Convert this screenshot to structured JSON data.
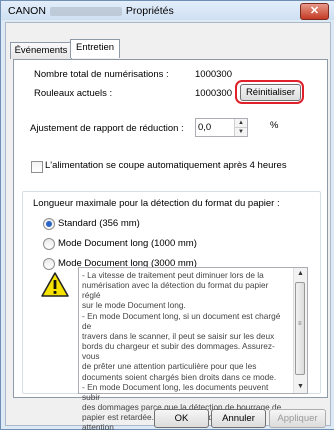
{
  "window": {
    "title_prefix": "CANON",
    "title_suffix": "Propriétés",
    "close_glyph": "✕"
  },
  "tabs": [
    {
      "label": "Événements",
      "active": false
    },
    {
      "label": "Entretien",
      "active": true
    }
  ],
  "scans": {
    "total_label": "Nombre total de numérisations :",
    "total_value": "1000300",
    "rollers_label": "Rouleaux actuels :",
    "rollers_value": "1000300",
    "reset_label": "Réinitialiser"
  },
  "reduction": {
    "label": "Ajustement de rapport de réduction :",
    "value": "0,0",
    "unit": "%"
  },
  "auto_off": {
    "label": "L'alimentation se coupe automatiquement après 4 heures",
    "checked": false
  },
  "paper_length": {
    "group_label": "Longueur maximale pour la détection du format du papier :",
    "options": [
      {
        "label": "Standard (356 mm)",
        "checked": true
      },
      {
        "label": "Mode Document long (1000 mm)",
        "checked": false
      },
      {
        "label": "Mode Document long (3000 mm)",
        "checked": false
      }
    ],
    "warning_icon": "warning-triangle-icon",
    "warning_text": "- La vitesse de traitement peut diminuer lors de la\nnumérisation avec la détection du format du papier réglé\nsur le mode Document long.\n- En mode Document long, si un document est chargé de\ntravers dans le scanner, il peut se saisir sur les deux\nbords du chargeur et subir des dommages. Assurez-vous\nde prêter une attention particulière pour que les\ndocuments soient chargés bien droits dans ce mode.\n- En mode Document long, les documents peuvent subir\ndes dommages parce que la détection de bourrage de\npapier est retardée. Assurez-vous de prêter une attention"
  },
  "footer": {
    "ok_label": "OK",
    "cancel_label": "Annuler",
    "apply_label": "Appliquer"
  },
  "colors": {
    "highlight": "#e0202a",
    "radio_selected": "#2a64c8"
  }
}
